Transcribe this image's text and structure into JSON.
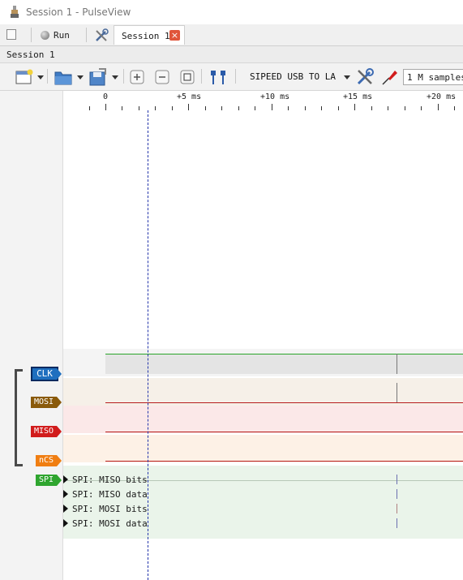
{
  "window": {
    "title": "Session 1 - PulseView"
  },
  "mainbar": {
    "run_label": "Run",
    "tab_label": "Session 1",
    "tab_close": "×"
  },
  "session": {
    "header": "Session 1"
  },
  "toolbar": {
    "device": "SIPEED USB TO LA",
    "samples": "1 M samples"
  },
  "ruler": {
    "ticks": [
      "0",
      "+5 ms",
      "+10 ms",
      "+15 ms",
      "+20 ms"
    ]
  },
  "channels": [
    {
      "name": "CLK",
      "color": "#1f6fbf"
    },
    {
      "name": "MOSI",
      "color": "#8a5a0a"
    },
    {
      "name": "MISO",
      "color": "#d11c1c"
    },
    {
      "name": "nCS",
      "color": "#f07e12"
    }
  ],
  "decoder": {
    "name": "SPI",
    "color": "#2fa52f",
    "rows": [
      "SPI: MISO bits",
      "SPI: MISO data",
      "SPI: MOSI bits",
      "SPI: MOSI data"
    ]
  },
  "icons": {
    "app": "pulseview-probe-icon",
    "new": "new-session-icon",
    "run": "run-icon",
    "tools": "device-config-icon",
    "open": "open-folder-icon",
    "save": "save-icon",
    "zoom_in": "zoom-in-icon",
    "zoom_out": "zoom-out-icon",
    "zoom_fit": "zoom-fit-icon",
    "cursors": "cursor-pair-icon",
    "probe": "probe-icon"
  }
}
